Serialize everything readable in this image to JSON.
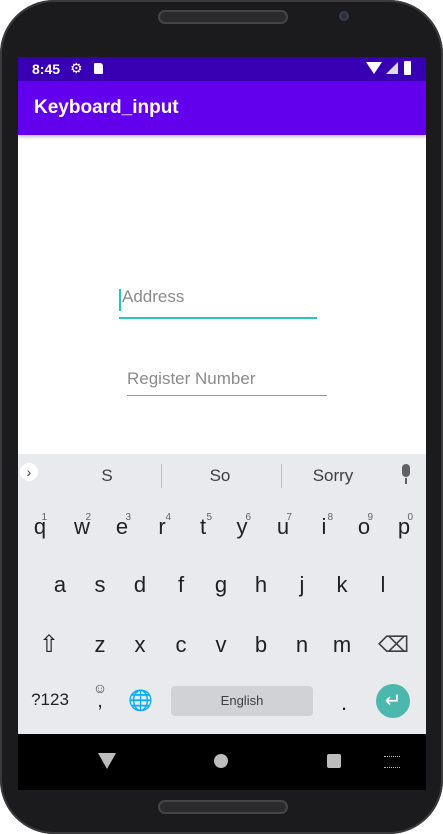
{
  "status_bar": {
    "time": "8:45",
    "gear_icon": "⚙"
  },
  "app_bar": {
    "title": "Keyboard_input"
  },
  "form": {
    "address_placeholder": "Address",
    "register_placeholder": "Register Number"
  },
  "keyboard": {
    "suggestions": [
      "S",
      "So",
      "Sorry"
    ],
    "expand_icon": "›",
    "row1": [
      {
        "k": "q",
        "h": "1"
      },
      {
        "k": "w",
        "h": "2"
      },
      {
        "k": "e",
        "h": "3"
      },
      {
        "k": "r",
        "h": "4"
      },
      {
        "k": "t",
        "h": "5"
      },
      {
        "k": "y",
        "h": "6"
      },
      {
        "k": "u",
        "h": "7"
      },
      {
        "k": "i",
        "h": "8"
      },
      {
        "k": "o",
        "h": "9"
      },
      {
        "k": "p",
        "h": "0"
      }
    ],
    "row2": [
      "a",
      "s",
      "d",
      "f",
      "g",
      "h",
      "j",
      "k",
      "l"
    ],
    "row3": [
      "z",
      "x",
      "c",
      "v",
      "b",
      "n",
      "m"
    ],
    "shift_icon": "⇧",
    "backspace_icon": "⌫",
    "symbols_label": "?123",
    "emoji_icon": "☺",
    "comma_label": ",",
    "globe_icon": "🌐",
    "space_label": "English",
    "period_label": ".",
    "enter_icon": "↵"
  },
  "colors": {
    "status_bar": "#3700b3",
    "app_bar": "#6200ee",
    "accent": "#26c6c0",
    "enter_key": "#4cb7ad"
  }
}
